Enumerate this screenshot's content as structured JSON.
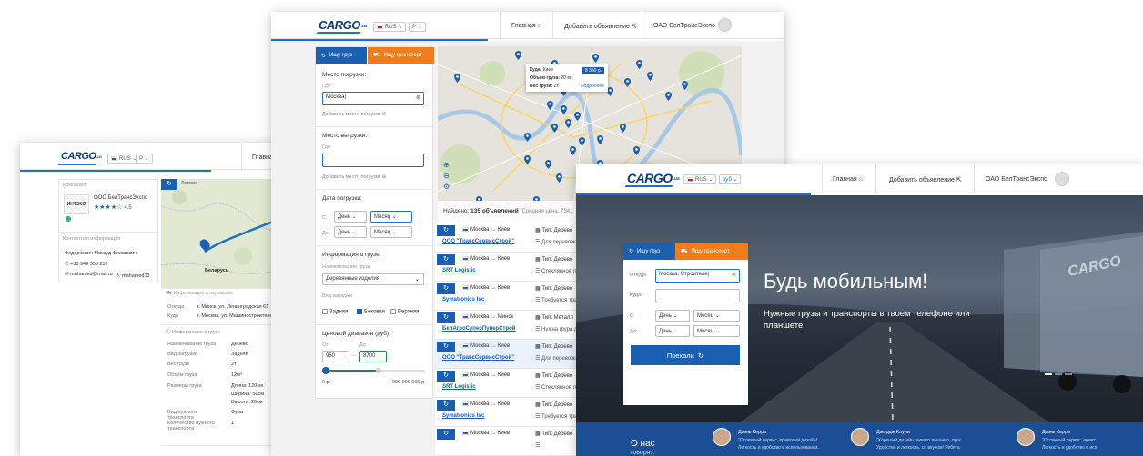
{
  "brand": {
    "logo": "CARGO",
    "logo_suffix": ".ua",
    "accent": "#1a73c6",
    "orange": "#f07c1a",
    "dark_blue": "#0b3d7a"
  },
  "left_window": {
    "lang": "RUS",
    "currency": "P",
    "nav_home": "Главная",
    "company_section": "Компания",
    "company_name": "ООО БелТрансЭкспо",
    "company_logo_text": "ИНТЭКО",
    "rating": "4.5",
    "contact_section": "Контактная информация",
    "contact_name": "Федоркевич Максуд Филаювич",
    "phone": "+38 949 555 252",
    "email": "mahamed@mail.ru",
    "skype": "mahamed13",
    "map_label_top": "Латвия",
    "map_label_bottom": "Беларусь",
    "map_marker": "A1",
    "transport_info_title": "Информация о перевозке",
    "from_label": "Откуда",
    "from_value": "г. Минск, ул. Ленинградская 61",
    "to_label": "Куда",
    "to_value": "г. Москва, ул. Машиностроителей 9",
    "cargo_info_title": "Информация о грузе",
    "cargo_rows": [
      {
        "k": "Наименование груза",
        "v": "Дерево"
      },
      {
        "k": "Вид загрузки",
        "v": "Задняя"
      },
      {
        "k": "Вес груза",
        "v": "2т"
      },
      {
        "k": "Объём груза",
        "v": "12м³"
      },
      {
        "k": "Размеры груза",
        "v": "Длина: 120см"
      },
      {
        "k": "",
        "v": "Ширина: 50см"
      },
      {
        "k": "",
        "v": "Высота: 20см"
      },
      {
        "k": "Вид нужного транспорта",
        "v": "Фура"
      },
      {
        "k": "Количество нужного транспорта",
        "v": "1"
      }
    ]
  },
  "middle_window": {
    "lang": "RUS",
    "currency": "P",
    "nav_home": "Главная",
    "nav_add": "Добавить объявление",
    "nav_company": "ОАО БелТрансЭкспо",
    "tab_cargo": "Ищу груз",
    "tab_transport": "Ищу транспорт",
    "load_place_title": "Место погрузки:",
    "where_label": "Где:",
    "load_value": "Москва",
    "add_load_link": "Добавить место погрузки",
    "unload_place_title": "Место выгрузки:",
    "unload_where_label": "Где:",
    "add_unload_link": "Добавить место погрузки",
    "date_title": "Дата погрузки:",
    "from_label": "С:",
    "to_label": "До:",
    "day_label": "День",
    "month_label": "Месяц",
    "cargo_info_title": "Информация о грузе:",
    "cargo_name_label": "Наименование груза",
    "cargo_name_value": "Деревянные изделия",
    "loading_type_label": "Вид загрузки",
    "loading_options": [
      {
        "label": "Задняя",
        "checked": false
      },
      {
        "label": "Боковая",
        "checked": true
      },
      {
        "label": "Верхняя",
        "checked": false
      }
    ],
    "price_title": "Ценовой диапазон (руб):",
    "price_from_label": "От",
    "price_to_label": "До",
    "price_from": "950",
    "price_to": "8700",
    "price_min": "0 р.",
    "price_max": "999 999 999 р",
    "popup": {
      "where_label": "Куда:",
      "where": "Киев",
      "volume_label": "Объем груза:",
      "volume": "20 м³",
      "weight_label": "Вес груза:",
      "weight": "2т.",
      "price": "8 350 р.",
      "more": "Подробнее"
    },
    "found_label": "Найдено:",
    "found_count": "135 объявлений",
    "avg_price": "(Средняя цена: 7341",
    "listings": [
      {
        "route": "Москва → Киев",
        "company": "ООО \"ТрансСервисСтрой\"",
        "type": "Тип: Дерево",
        "type_rest": "Вес",
        "sub": "Для перевозки д",
        "hl": false
      },
      {
        "route": "Москва → Киев",
        "company": "SRT Logistic",
        "type": "Тип: Дерево",
        "type_rest": "Вес",
        "sub": "Стеклянное пере",
        "hl": false
      },
      {
        "route": "Москва → Киев",
        "company": "Symatronics Inc",
        "type": "Тип: Дерево",
        "type_rest": "Вес",
        "sub": "Требуется транс",
        "hl": false
      },
      {
        "route": "Москва → Минск",
        "company": "БелАгроСуперПуперСтрой",
        "type": "Тип: Металл",
        "type_rest": "Вес",
        "sub": "Нужна фура для",
        "hl": false
      },
      {
        "route": "Москва → Киев",
        "company": "ООО \"ТрансСервисСтрой\"",
        "type": "Тип: Дерево",
        "type_rest": "Вес",
        "sub": "Для перевозки д",
        "hl": true
      },
      {
        "route": "Москва → Киев",
        "company": "SRT Logistic",
        "type": "Тип: Дерево",
        "type_rest": "Вес",
        "sub": "Стеклянное пере",
        "hl": false
      },
      {
        "route": "Москва → Киев",
        "company": "Symatronics Inc",
        "type": "Тип: Дерево",
        "type_rest": "Вес",
        "sub": "Требуется транс",
        "hl": false
      },
      {
        "route": "Москва → Киев",
        "company": "",
        "type": "Тип: Дерево",
        "type_rest": "",
        "sub": "",
        "hl": false
      }
    ]
  },
  "right_window": {
    "lang": "RUS",
    "currency": "руб",
    "nav_home": "Главная",
    "nav_add": "Добавить объявление",
    "nav_company": "ОАО БелТрансЭкспо",
    "tab_cargo": "Ищу груз",
    "tab_transport": "Ищу транспорт",
    "from_label": "Откуда",
    "from_value": "Москва, Строителе",
    "to_label": "Куда:",
    "date_from_label": "С:",
    "date_to_label": "До:",
    "day_label": "День",
    "month_label": "Месяц",
    "go_button": "Поехали",
    "hero_title": "Будь мобильным!",
    "hero_sub": "Нужные грузы и транспорты в твоем телефоне или планшете",
    "truck_text": "CARGO",
    "about_title": "О нас",
    "about_sub": "говорят:",
    "testimonials": [
      {
        "name": "Джим Керри",
        "text": "\"Отличный сервис, приятный дизайн!",
        "text2": "Легкость и удобство в использовании."
      },
      {
        "name": "Джордж Клуни",
        "text": "\"Хороший дизайн, ничего лишнего, прос",
        "text2": "Удобство и легкость, со вкусом! Ребята"
      },
      {
        "name": "Джим Керри",
        "text": "\"Отличный сервис, прият",
        "text2": "Легкость и удобство в исп"
      }
    ]
  }
}
